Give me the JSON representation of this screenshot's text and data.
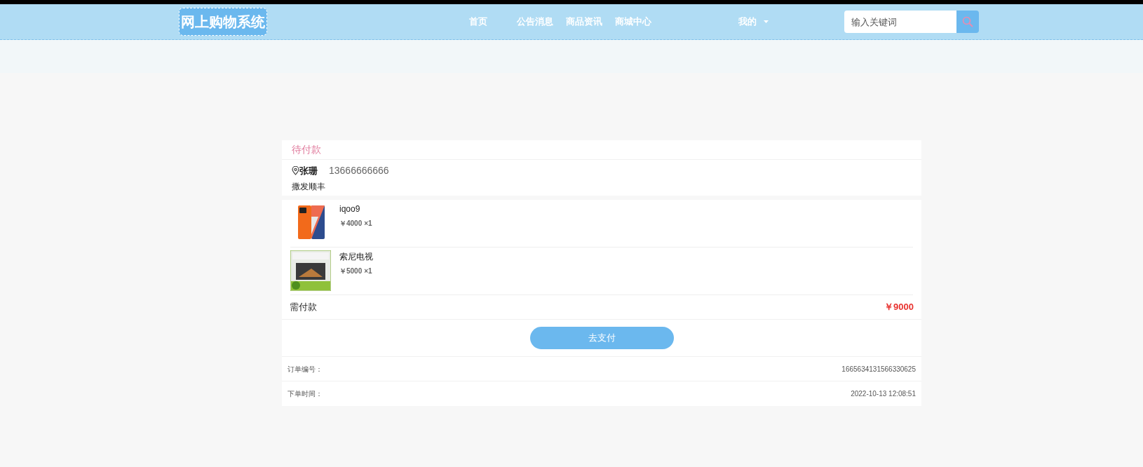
{
  "header": {
    "logo": "网上购物系统",
    "nav": [
      {
        "label": "首页"
      },
      {
        "label": "公告消息"
      },
      {
        "label": "商品资讯"
      },
      {
        "label": "商城中心"
      }
    ],
    "user_menu": "我的",
    "search": {
      "placeholder": "输入关键词"
    }
  },
  "order": {
    "status": "待付款",
    "recipient": "张珊",
    "phone": "13666666666",
    "address": "撒发顺丰",
    "items": [
      {
        "name": "iqoo9",
        "price": "￥4000",
        "quantity": "×1",
        "kind": "phone"
      },
      {
        "name": "索尼电视",
        "price": "￥5000",
        "quantity": "×1",
        "kind": "tv"
      }
    ],
    "total_label": "需付款",
    "total": "￥9000",
    "pay_button": "去支付",
    "details": [
      {
        "label": "订单编号：",
        "value": "1665634131566330625"
      },
      {
        "label": "下单时间：",
        "value": "2022-10-13 12:08:51"
      }
    ]
  }
}
